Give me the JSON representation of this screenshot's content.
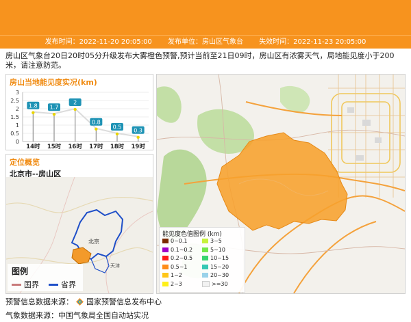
{
  "info_bar": {
    "publish_time": "发布时间：2022-11-20 20:05:00",
    "publisher": "发布单位：房山区气象台",
    "expire_time": "失效时间：2022-11-23 20:05:00"
  },
  "description": "房山区气象台20日20时05分升级发布大雾橙色预警,预计当前至21日09时，房山区有浓雾天气，局地能见度小于200米，请注意防范。",
  "chart_card": {
    "title": "房山当地能见度实况(km)"
  },
  "chart_data": {
    "type": "line",
    "title": "房山当地能见度实况(km)",
    "categories": [
      "14时",
      "15时",
      "16时",
      "17时",
      "18时",
      "19时"
    ],
    "values": [
      1.8,
      1.7,
      2,
      0.8,
      0.5,
      0.3
    ],
    "labels": [
      "1.8",
      "1.7",
      "2",
      "0.8",
      "0.5",
      "0.3"
    ],
    "ylim": [
      0,
      3
    ],
    "yticks": [
      "3",
      "2.5",
      "2",
      "1.5",
      "1",
      "0.5",
      "0"
    ],
    "grid": true,
    "colors": {
      "line": "#dcdcdc",
      "label_bg": "#1f93b5",
      "point": "#e8d400",
      "bar": "#8f8f8f"
    }
  },
  "location_card": {
    "title": "定位概览",
    "region": "北京市--房山区",
    "map_labels": {
      "beijing": "北京",
      "tianjin": "天津"
    },
    "legend_title": "图例",
    "legend_items": [
      {
        "label": "国界",
        "color": "#c87a7a"
      },
      {
        "label": "省界",
        "color": "#1f4fc8"
      }
    ]
  },
  "visibility_legend": {
    "title": "能见度色值图例 (km)",
    "items": [
      {
        "label": "0~0.1",
        "color": "#7b2a00"
      },
      {
        "label": "3~5",
        "color": "#c7f23c"
      },
      {
        "label": "0.1~0.2",
        "color": "#a000c8"
      },
      {
        "label": "5~10",
        "color": "#74e84a"
      },
      {
        "label": "0.2~0.5",
        "color": "#ff1a1a"
      },
      {
        "label": "10~15",
        "color": "#38d56f"
      },
      {
        "label": "0.5~1",
        "color": "#ff8c1a"
      },
      {
        "label": "15~20",
        "color": "#36c8b4"
      },
      {
        "label": "1~2",
        "color": "#ffc61a"
      },
      {
        "label": "20~30",
        "color": "#9ad2ea"
      },
      {
        "label": "2~3",
        "color": "#fff01a"
      },
      {
        "label": ">=30",
        "color": "#f2f2f2"
      }
    ]
  },
  "footer": {
    "warning_source_label": "预警信息数据来源：",
    "warning_source": "国家预警信息发布中心",
    "weather_source": "气象数据来源：中国气象局全国自动站实况"
  }
}
